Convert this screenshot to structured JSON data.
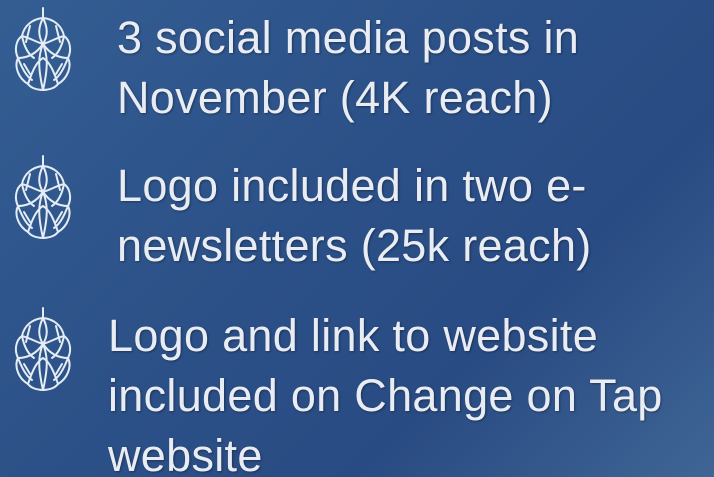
{
  "bullets": [
    {
      "icon": "hop-cone-icon",
      "text": "3 social media posts in\nNovember (4K reach)"
    },
    {
      "icon": "hop-cone-icon",
      "text": "Logo included in two e-\nnewsletters (25k reach)"
    },
    {
      "icon": "hop-cone-icon",
      "text": "Logo and link to website\nincluded on Change on Tap\nwebsite"
    }
  ],
  "colors": {
    "background": "#2c4f86",
    "text": "#e9edf3",
    "icon_stroke": "#e4ecf4"
  }
}
